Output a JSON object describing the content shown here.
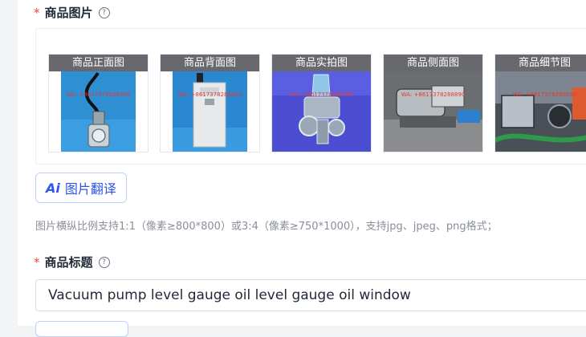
{
  "images_section": {
    "required_mark": "*",
    "label": "商品图片",
    "help_icon": "?",
    "thumbnails": [
      {
        "caption": "商品正面图",
        "watermark": "WA: +8617378288890"
      },
      {
        "caption": "商品背面图",
        "watermark": "WA: +8617378288890"
      },
      {
        "caption": "商品实拍图",
        "watermark": "WA: +8617378288890"
      },
      {
        "caption": "商品侧面图",
        "watermark": "WA: +8617378288890"
      },
      {
        "caption": "商品细节图",
        "watermark": "WA: +8617378288890"
      }
    ],
    "translate_button": {
      "icon": "Ai",
      "label": "图片翻译"
    },
    "hint": "图片横纵比例支持1:1（像素≥800*800）或3:4（像素≥750*1000），支持jpg、jpeg、png格式；"
  },
  "title_section": {
    "required_mark": "*",
    "label": "商品标题",
    "help_icon": "?",
    "value": "Vacuum pump level gauge oil level gauge oil window"
  },
  "colors": {
    "accent": "#2f54eb",
    "required": "#ef4444"
  }
}
